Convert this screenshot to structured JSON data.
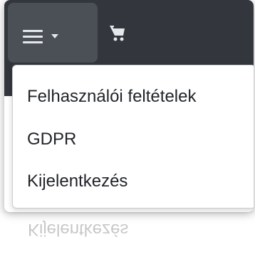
{
  "navbar": {
    "menu_toggle_icon": "hamburger-icon",
    "caret_icon": "caret-down-icon",
    "cart_icon": "cart-icon"
  },
  "dropdown": {
    "items": [
      {
        "label": "Felhasználói feltételek"
      },
      {
        "label": "GDPR"
      },
      {
        "label": "Kijelentkezés"
      }
    ]
  },
  "reflection": {
    "label": "Kijelentkezés"
  },
  "colors": {
    "navbar_bg": "#33373d",
    "toggle_bg": "#4a5056",
    "icon_color": "#e5e7ea",
    "text_color": "#212529"
  }
}
